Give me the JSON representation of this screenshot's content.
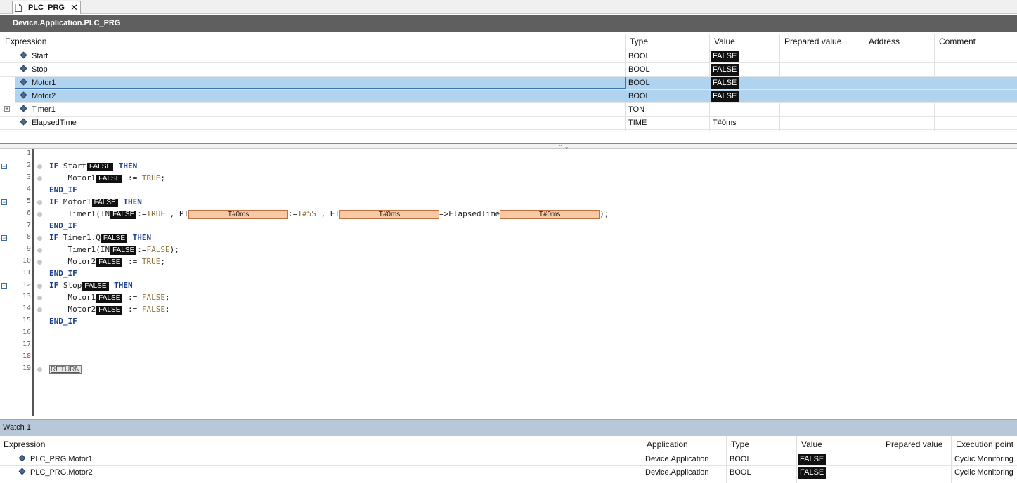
{
  "tab": {
    "title": "PLC_PRG",
    "close": "✕",
    "icon": "document-icon"
  },
  "pou_path": "Device.Application.PLC_PRG",
  "decl": {
    "columns": [
      "Expression",
      "Type",
      "Value",
      "Prepared value",
      "Address",
      "Comment"
    ],
    "rows": [
      {
        "name": "Start",
        "type": "BOOL",
        "value": "FALSE",
        "selected": false
      },
      {
        "name": "Stop",
        "type": "BOOL",
        "value": "FALSE",
        "selected": false
      },
      {
        "name": "Motor1",
        "type": "BOOL",
        "value": "FALSE",
        "selected": true
      },
      {
        "name": "Motor2",
        "type": "BOOL",
        "value": "FALSE",
        "selected": true
      },
      {
        "name": "Timer1",
        "type": "TON",
        "value": "",
        "selected": false,
        "expandable": true
      },
      {
        "name": "ElapsedTime",
        "type": "TIME",
        "value": "T#0ms",
        "selected": false
      }
    ]
  },
  "splitter_arrows": "⌃⌄",
  "code": {
    "line_numbers": [
      "1",
      "2",
      "3",
      "4",
      "5",
      "6",
      "7",
      "8",
      "9",
      "10",
      "11",
      "12",
      "13",
      "14",
      "15",
      "16",
      "17",
      "18",
      "19"
    ],
    "fold_marker": "−",
    "kw": {
      "if": "IF",
      "then": "THEN",
      "end_if": "END_IF"
    },
    "ident": {
      "start": "Start",
      "motor1": "Motor1",
      "motor2": "Motor2",
      "stop": "Stop",
      "timer1_call": "Timer1(IN",
      "timer1_q": "Timer1.Q",
      "pt": " , PT",
      "et": " , ET",
      "arrow_elapsed": "=>ElapsedTime",
      "close": ");",
      "assign": " := ",
      "assign_in": ":=",
      "assign_in_pt": ":="
    },
    "lit": {
      "true": "TRUE",
      "false": "FALSE",
      "t5s": "T#5S"
    },
    "mon": {
      "false": "FALSE",
      "t0": "T#0ms"
    },
    "return": "RETURN"
  },
  "watch": {
    "title": "Watch 1",
    "columns": [
      "Expression",
      "Application",
      "Type",
      "Value",
      "Prepared value",
      "Execution point"
    ],
    "rows": [
      {
        "expr": "PLC_PRG.Motor1",
        "app": "Device.Application",
        "type": "BOOL",
        "value": "FALSE",
        "exec": "Cyclic Monitoring"
      },
      {
        "expr": "PLC_PRG.Motor2",
        "app": "Device.Application",
        "type": "BOOL",
        "value": "FALSE",
        "exec": "Cyclic Monitoring"
      }
    ]
  },
  "colors": {
    "selection": "#b0d3ef",
    "monitor_bool": "#111111",
    "monitor_time": "#f8c9a5",
    "keyword": "#1a3f8f",
    "literal": "#8d7338"
  }
}
